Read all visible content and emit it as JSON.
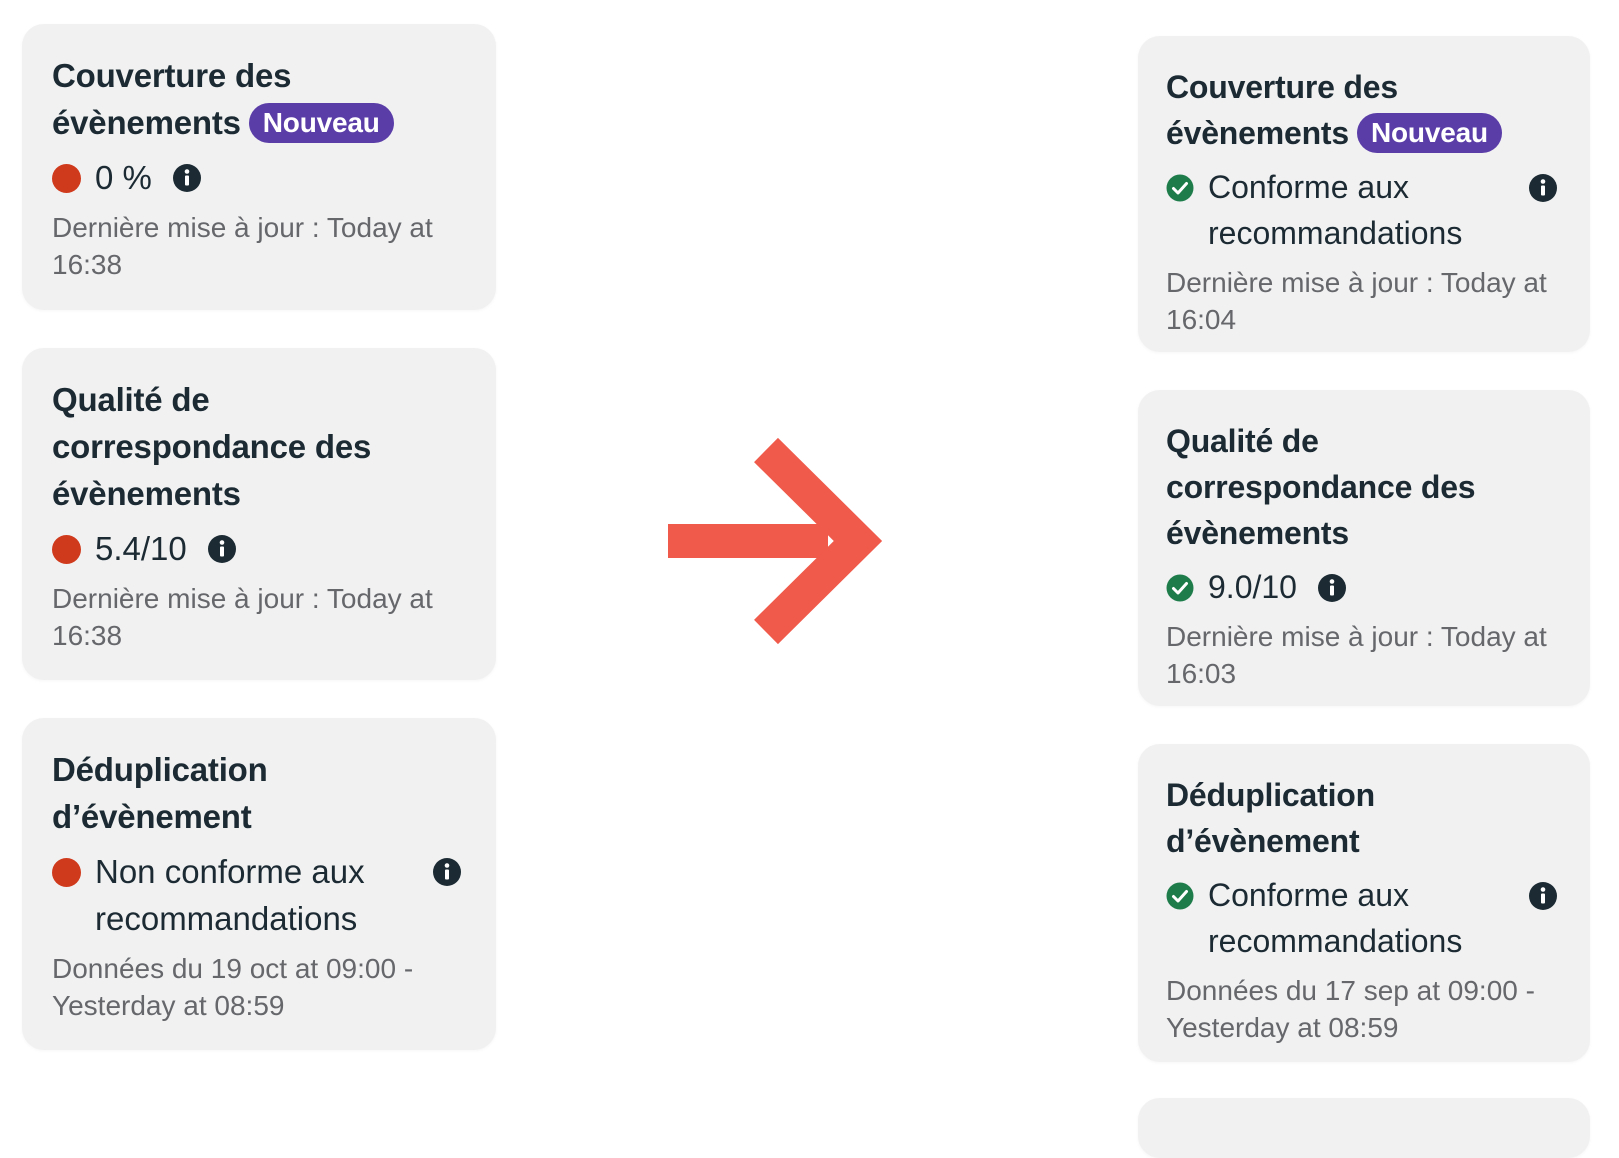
{
  "colors": {
    "badge": "#5b3da8",
    "status_bad": "#d03a1c",
    "status_good": "#1e7c4a",
    "arrow": "#f05a4a",
    "card_bg": "#f1f1f2"
  },
  "before": {
    "event_coverage": {
      "title_line1": "Couverture des",
      "title_line2": "évènements",
      "badge": "Nouveau",
      "status": "bad",
      "value": "0 %",
      "updated": "Dernière mise à jour : Today at 16:38"
    },
    "match_quality": {
      "title": "Qualité de correspondance des évènements",
      "status": "bad",
      "value": "5.4/10",
      "updated": "Dernière mise à jour : Today at 16:38"
    },
    "deduplication": {
      "title": "Déduplication d’évènement",
      "status": "bad",
      "value": "Non conforme aux recommandations",
      "range": "Données du 19 oct at 09:00 - Yesterday at 08:59"
    }
  },
  "after": {
    "event_coverage": {
      "title_line1": "Couverture des",
      "title_line2": "évènements",
      "badge": "Nouveau",
      "status": "good",
      "value": "Conforme aux recommandations",
      "updated": "Dernière mise à jour : Today at 16:04"
    },
    "match_quality": {
      "title": "Qualité de correspondance des évènements",
      "status": "good",
      "value": "9.0/10",
      "updated": "Dernière mise à jour : Today at 16:03"
    },
    "deduplication": {
      "title": "Déduplication d’évènement",
      "status": "good",
      "value": "Conforme aux recommandations",
      "range": "Données du 17 sep at 09:00 - Yesterday at 08:59"
    }
  },
  "icons": {
    "info": "info-icon",
    "check": "check-circle-icon",
    "status_dot": "red-status-dot",
    "arrow": "arrow-right-icon"
  }
}
